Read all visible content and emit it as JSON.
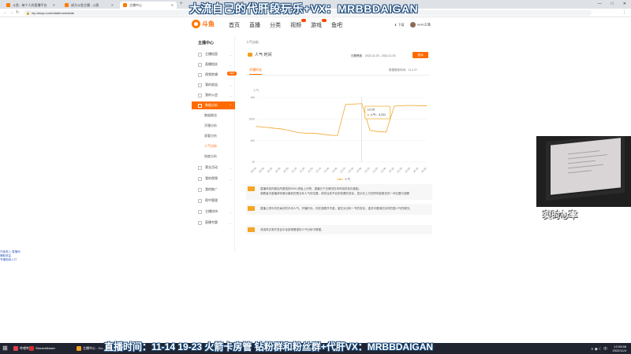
{
  "browser": {
    "tabs": [
      {
        "title": "斗鱼 - 每个人的直播平台",
        "active": false,
        "color": "#ff7a00"
      },
      {
        "title": "成为斗鱼主播 - 斗鱼",
        "active": false,
        "color": "#ff7a00"
      },
      {
        "title": "主播中心",
        "active": true,
        "color": "#ff7a00"
      }
    ],
    "new_tab": "+",
    "url": "mp.douyu.com/data/roomstats",
    "window_controls": [
      "—",
      "□",
      "✕"
    ]
  },
  "overlay": {
    "top_text": "大流自己的代肝段玩乐+VX：MRBBDAIGAN",
    "bottom_text": "直播时间：11-14 19-23 火箭卡房管 钻粉群和粉丝群+代肝VX：MRBBDAIGAN",
    "cam_text": "实时心率"
  },
  "header": {
    "logo_text": "斗鱼",
    "nav": [
      {
        "label": "首页",
        "badge": false
      },
      {
        "label": "直播",
        "badge": false
      },
      {
        "label": "分类",
        "badge": false
      },
      {
        "label": "视频",
        "badge": true
      },
      {
        "label": "游戏",
        "badge": true
      },
      {
        "label": "鱼吧",
        "badge": false
      }
    ],
    "download": "下载",
    "user_name": "Hello主播"
  },
  "sidebar": {
    "title": "主播中心",
    "items": [
      {
        "label": "主播档案",
        "active": false,
        "arrow": "⌄"
      },
      {
        "label": "直播相关",
        "active": false,
        "arrow": "⌄"
      },
      {
        "label": "视频剪辑",
        "active": false,
        "arrow": ""
      },
      {
        "label": "我的收益",
        "active": false,
        "arrow": "⌄"
      },
      {
        "label": "我的公会",
        "active": false,
        "arrow": "⌄"
      },
      {
        "label": "数据分析",
        "active": true,
        "arrow": "⌃"
      }
    ],
    "subitems": [
      "数据概览",
      "开播分析",
      "观看分析",
      "人气分析",
      "热度分析"
    ],
    "current_sub": 3,
    "items2": [
      {
        "label": "营业活动",
        "arrow": "⌄"
      },
      {
        "label": "我的视频",
        "arrow": "⌄"
      },
      {
        "label": "我的推广",
        "arrow": ""
      },
      {
        "label": "帮中管理",
        "arrow": ""
      },
      {
        "label": "主播扶持",
        "arrow": "⌄"
      },
      {
        "label": "直播专题",
        "arrow": "⌄"
      }
    ],
    "new_tag": "NEW"
  },
  "main": {
    "breadcrumb": "人气分析",
    "panel_title": "人气·时间",
    "date_label": "日期筛选",
    "date_range": "2022-11-03 - 2022-11-03",
    "query_button": "查询",
    "chart_tab": "开播时长",
    "refresh_time": "数据更新时间：11-3 07",
    "notes": [
      {
        "num": "1",
        "lines": [
          "直播时段内超出所属档的0000-底板上升势，重播已下去情况在本时段的变化差距。",
          "观看者次重播请你展示最前的是当年人气的位置，请将当前节目的效果的变化，显示在上方的同时能更多的一块位置与观察"
        ]
      },
      {
        "num": "2",
        "lines": [
          "直播上吧中内在每次的平均人气、开播时长。你在观看开不重，重在对当年一节的变化，重并可看清在实时的整人气的情况。"
        ]
      },
      {
        "num": "3",
        "lines": [
          "请选择正常开发会中全部观看重的人气分析中数据。"
        ]
      }
    ]
  },
  "chart_data": {
    "type": "line",
    "title": "",
    "ylabel": "人气",
    "yscale": "log",
    "yticks": [
      10,
      100,
      1000,
      "10k"
    ],
    "x": [
      "09:30",
      "09:50",
      "10:10",
      "10:30",
      "10:50",
      "11:10",
      "11:30",
      "11:50",
      "12:10",
      "12:30",
      "12:50",
      "13:10",
      "13:30",
      "13:50",
      "14:10",
      "14:30",
      "14:50",
      "15:10",
      "15:30",
      "15:50",
      "16:10",
      "16:30"
    ],
    "series": [
      {
        "name": "人气",
        "color": "#f0a830",
        "values": [
          450,
          420,
          380,
          350,
          300,
          240,
          220,
          220,
          200,
          180,
          170,
          4800,
          5000,
          5200,
          300,
          260,
          250,
          4000,
          4200,
          4300,
          4200,
          4100
        ]
      }
    ],
    "tooltip": {
      "time": "12:29",
      "label": "人气",
      "value": "5,231"
    },
    "legend": "人气"
  },
  "left_links": [
    "升级收入·直播间",
    "赚取收益",
    "专播指南入口"
  ],
  "taskbar": {
    "start": "⊞",
    "apps": [
      {
        "label": "哔哩哔哩",
        "color": "#e04050"
      },
      {
        "label": "StreamMaster",
        "color": "#d03030"
      },
      {
        "label": "主播中心 - Go...",
        "color": "#f0a020"
      }
    ],
    "tray": "∧ ◆ ☾ 中",
    "time": "12:05:58",
    "date": "2022/11/4"
  }
}
